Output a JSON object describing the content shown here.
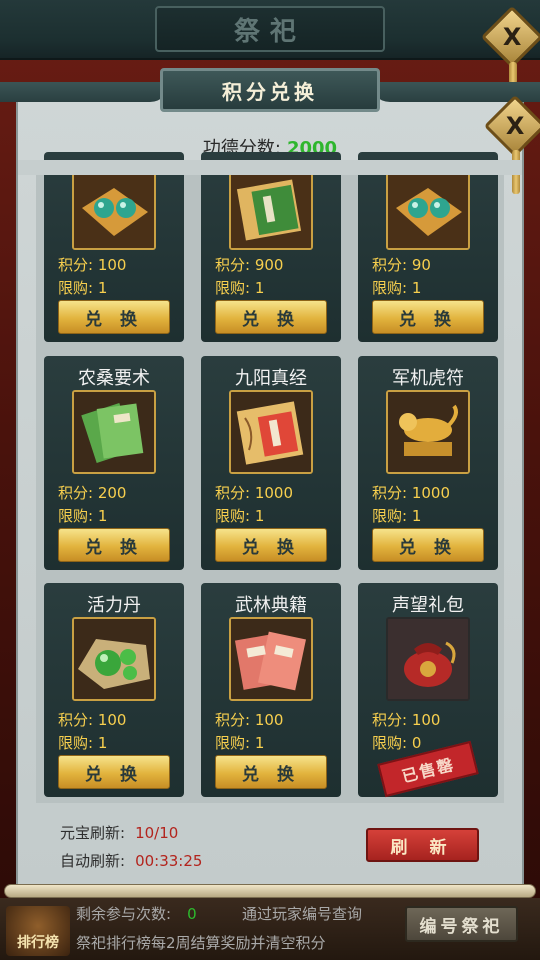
{
  "window": {
    "title": "祭祀",
    "close_label": "X"
  },
  "panel": {
    "title": "积分兑换",
    "close_label": "X"
  },
  "score": {
    "label": "功德分数:",
    "value": "2000"
  },
  "items": [
    {
      "name": "",
      "icon": "jade-orbs-icon",
      "points": "积分: 100",
      "limit": "限购: 1",
      "button": "兑 换"
    },
    {
      "name": "",
      "icon": "book-case-icon",
      "points": "积分: 900",
      "limit": "限购: 1",
      "button": "兑 换"
    },
    {
      "name": "",
      "icon": "jade-orbs-icon",
      "points": "积分: 90",
      "limit": "限购: 1",
      "button": "兑 换"
    },
    {
      "name": "农桑要术",
      "icon": "green-book-icon",
      "points": "积分: 200",
      "limit": "限购: 1",
      "button": "兑 换"
    },
    {
      "name": "九阳真经",
      "icon": "book-case-icon",
      "points": "积分: 1000",
      "limit": "限购: 1",
      "button": "兑 换"
    },
    {
      "name": "军机虎符",
      "icon": "golden-tiger-icon",
      "points": "积分: 1000",
      "limit": "限购: 1",
      "button": "兑 换"
    },
    {
      "name": "活力丹",
      "icon": "green-pills-icon",
      "points": "积分: 100",
      "limit": "限购: 1",
      "button": "兑 换"
    },
    {
      "name": "武林典籍",
      "icon": "red-books-icon",
      "points": "积分: 100",
      "limit": "限购: 1",
      "button": "兑 换"
    },
    {
      "name": "声望礼包",
      "icon": "red-pouch-icon",
      "points": "积分: 100",
      "limit": "限购: 0",
      "button": "",
      "sold_label": "已售罄"
    }
  ],
  "refresh": {
    "yuanbao_label": "元宝刷新:",
    "yuanbao_value": "10/10",
    "auto_label": "自动刷新:",
    "auto_value": "00:33:25",
    "button": "刷 新"
  },
  "bottom": {
    "rank_label": "排行榜",
    "remaining_label": "剩余参与次数:",
    "remaining_value": "0",
    "query_text": "通过玩家编号查询",
    "rule_text": "祭祀排行榜每2周结算奖励并清空积分",
    "number_button": "编号祭祀"
  },
  "colors": {
    "accent_gold": "#e2b33d",
    "score_green": "#2fb62e",
    "sold_red": "#c2262a",
    "card_bg": "#22393a"
  }
}
